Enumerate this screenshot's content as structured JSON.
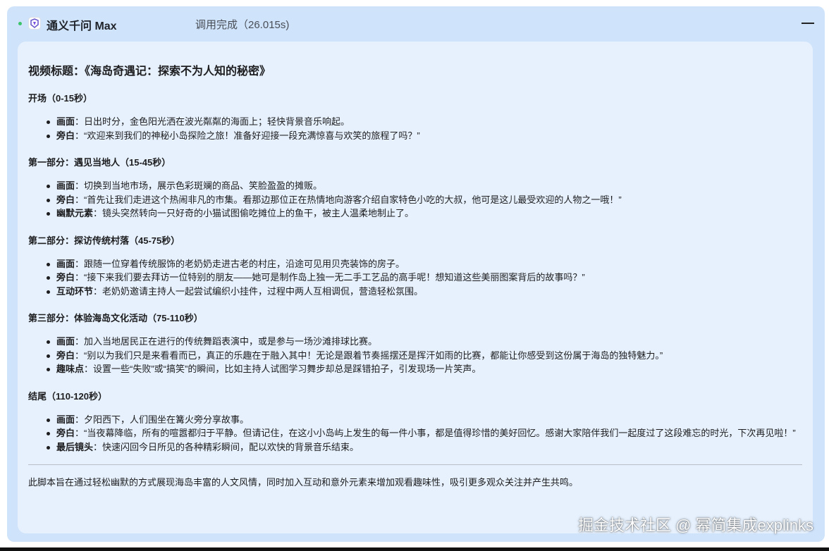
{
  "header": {
    "app_name": "通义千问 Max",
    "status": "调用完成（26.015s)",
    "logo_icon": "tongyi-logo-icon",
    "status_color": "#3cc46b"
  },
  "script": {
    "title": "视频标题：《海岛奇遇记：探索不为人知的秘密》",
    "sections": [
      {
        "heading": "开场（0-15秒）",
        "items": [
          {
            "label": "画面",
            "text": "：日出时分，金色阳光洒在波光粼粼的海面上；轻快背景音乐响起。"
          },
          {
            "label": "旁白",
            "text": "：“欢迎来到我们的神秘小岛探险之旅！准备好迎接一段充满惊喜与欢笑的旅程了吗？”"
          }
        ]
      },
      {
        "heading": "第一部分：遇见当地人（15-45秒）",
        "items": [
          {
            "label": "画面",
            "text": "：切换到当地市场，展示色彩斑斓的商品、笑脸盈盈的摊贩。"
          },
          {
            "label": "旁白",
            "text": "：“首先让我们走进这个热闹非凡的市集。看那边那位正在热情地向游客介绍自家特色小吃的大叔，他可是这儿最受欢迎的人物之一哦！”"
          },
          {
            "label": "幽默元素",
            "text": "：镜头突然转向一只好奇的小猫试图偷吃摊位上的鱼干，被主人温柔地制止了。"
          }
        ]
      },
      {
        "heading": "第二部分：探访传统村落（45-75秒）",
        "items": [
          {
            "label": "画面",
            "text": "：跟随一位穿着传统服饰的老奶奶走进古老的村庄，沿途可见用贝壳装饰的房子。"
          },
          {
            "label": "旁白",
            "text": "：“接下来我们要去拜访一位特别的朋友——她可是制作岛上独一无二手工艺品的高手呢！想知道这些美丽图案背后的故事吗？”"
          },
          {
            "label": "互动环节",
            "text": "：老奶奶邀请主持人一起尝试编织小挂件，过程中两人互相调侃，营造轻松氛围。"
          }
        ]
      },
      {
        "heading": "第三部分：体验海岛文化活动（75-110秒）",
        "items": [
          {
            "label": "画面",
            "text": "：加入当地居民正在进行的传统舞蹈表演中，或是参与一场沙滩排球比赛。"
          },
          {
            "label": "旁白",
            "text": "：“别以为我们只是来看看而已，真正的乐趣在于融入其中！无论是跟着节奏摇摆还是挥汗如雨的比赛，都能让你感受到这份属于海岛的独特魅力。”"
          },
          {
            "label": "趣味点",
            "text": "：设置一些“失败”或“搞笑”的瞬间，比如主持人试图学习舞步却总是踩错拍子，引发现场一片笑声。"
          }
        ]
      },
      {
        "heading": "结尾（110-120秒）",
        "items": [
          {
            "label": "画面",
            "text": "：夕阳西下，人们围坐在篝火旁分享故事。"
          },
          {
            "label": "旁白",
            "text": "：“当夜幕降临，所有的喧嚣都归于平静。但请记住，在这小小岛屿上发生的每一件小事，都是值得珍惜的美好回忆。感谢大家陪伴我们一起度过了这段难忘的时光，下次再见啦！”"
          },
          {
            "label": "最后镜头",
            "text": "：快速闪回今日所见的各种精彩瞬间，配以欢快的背景音乐结束。"
          }
        ]
      }
    ],
    "summary": "此脚本旨在通过轻松幽默的方式展现海岛丰富的人文风情，同时加入互动和意外元素来增加观看趣味性，吸引更多观众关注并产生共鸣。"
  },
  "watermark": "掘金技术社区 @ 幂简集成explinks"
}
